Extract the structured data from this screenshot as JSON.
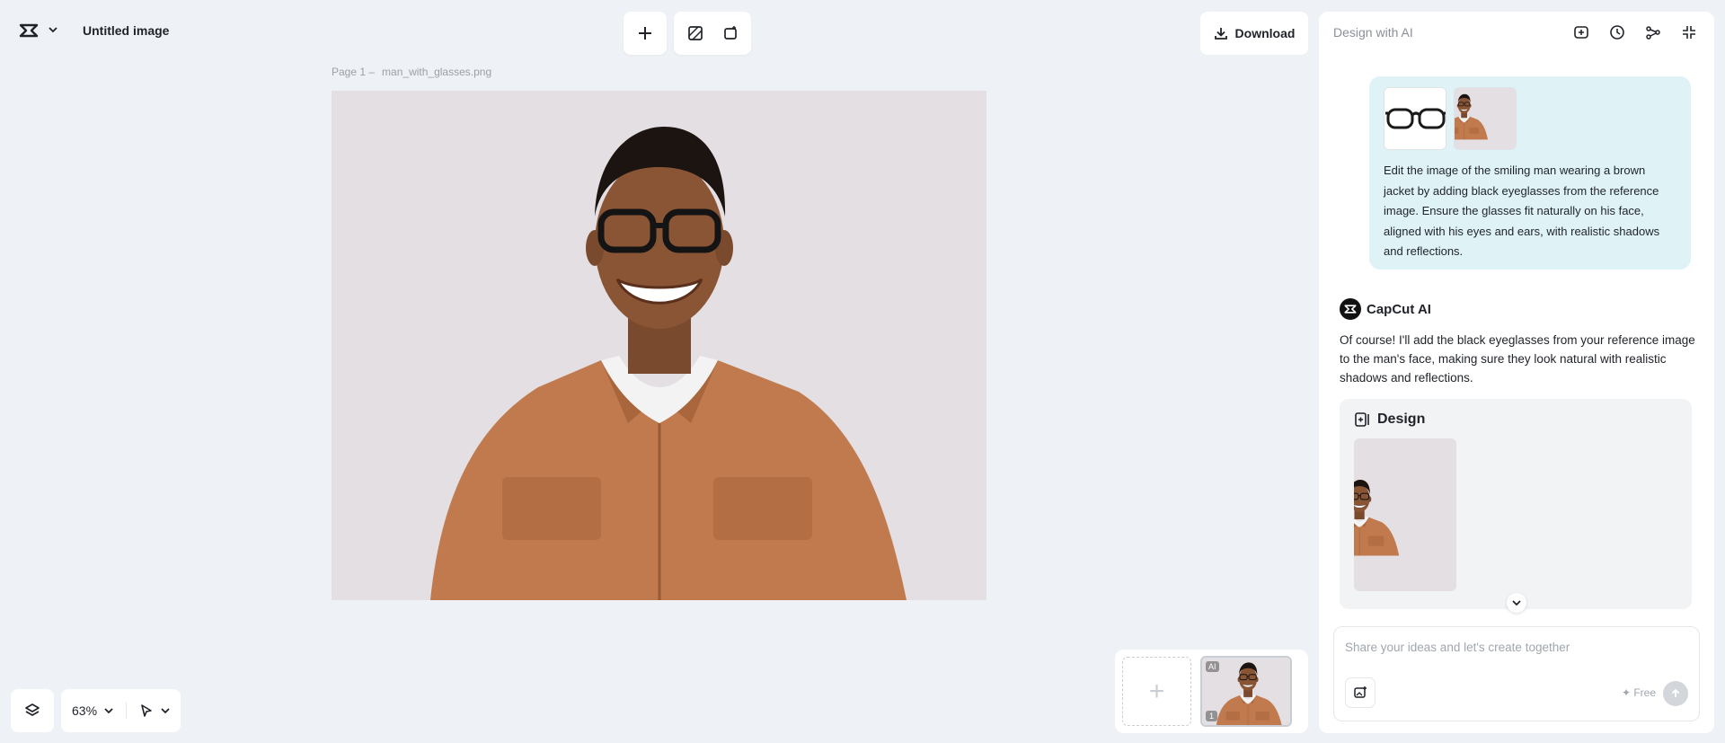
{
  "header": {
    "doc_title": "Untitled image",
    "download_label": "Download"
  },
  "canvas": {
    "page_label": "Page 1 –",
    "file_name": "man_with_glasses.png"
  },
  "bottom": {
    "zoom": "63%"
  },
  "pages": {
    "thumb_badge": "AI",
    "thumb_number": "1"
  },
  "panel": {
    "title": "Design with AI",
    "user_prompt": "Edit the image of the smiling man wearing a brown jacket by adding black eyeglasses from the reference image. Ensure the glasses fit naturally on his face, aligned with his eyes and ears, with realistic shadows and reflections.",
    "ai_name": "CapCut AI",
    "ai_reply": "Of course! I'll add the black eyeglasses from your reference image to the man's face, making sure they look natural with realistic shadows and reflections.",
    "design_title": "Design",
    "input_placeholder": "Share your ideas and let's create together",
    "free_label": "✦ Free"
  },
  "colors": {
    "background": "#eef1f5",
    "user_bubble": "#dff3f7",
    "jacket": "#c07a4e"
  }
}
